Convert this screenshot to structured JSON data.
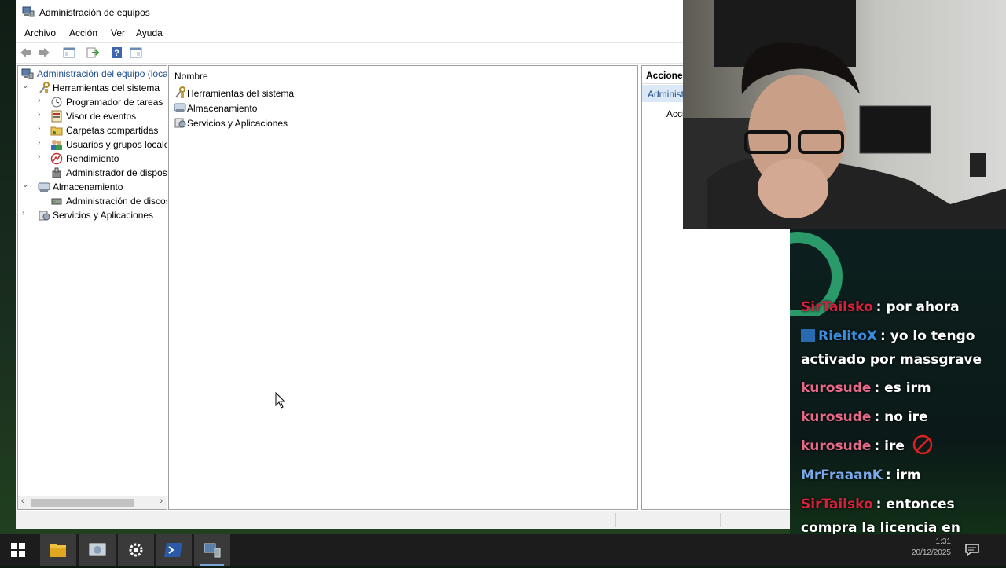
{
  "window": {
    "title": "Administración de equipos",
    "menu": [
      "Archivo",
      "Acción",
      "Ver",
      "Ayuda"
    ]
  },
  "tree": {
    "root": "Administración del equipo (local)",
    "items": [
      {
        "label": "Herramientas del sistema",
        "level": 1,
        "expanded": true,
        "icon": "tools-icon"
      },
      {
        "label": "Programador de tareas",
        "level": 2,
        "expanded": false,
        "icon": "clock-icon"
      },
      {
        "label": "Visor de eventos",
        "level": 2,
        "expanded": false,
        "icon": "event-viewer-icon"
      },
      {
        "label": "Carpetas compartidas",
        "level": 2,
        "expanded": false,
        "icon": "shared-folder-icon"
      },
      {
        "label": "Usuarios y grupos locales",
        "level": 2,
        "expanded": false,
        "icon": "users-icon"
      },
      {
        "label": "Rendimiento",
        "level": 2,
        "expanded": false,
        "icon": "performance-icon"
      },
      {
        "label": "Administrador de dispositivos",
        "level": 2,
        "expanded": null,
        "icon": "device-manager-icon"
      },
      {
        "label": "Almacenamiento",
        "level": 1,
        "expanded": true,
        "icon": "storage-icon"
      },
      {
        "label": "Administración de discos",
        "level": 2,
        "expanded": null,
        "icon": "disk-icon"
      },
      {
        "label": "Servicios y Aplicaciones",
        "level": 1,
        "expanded": false,
        "icon": "services-icon"
      }
    ]
  },
  "content": {
    "column_header": "Nombre",
    "rows": [
      {
        "label": "Herramientas del sistema",
        "icon": "tools-icon"
      },
      {
        "label": "Almacenamiento",
        "icon": "storage-icon"
      },
      {
        "label": "Servicios y Aplicaciones",
        "icon": "services-icon"
      }
    ]
  },
  "actions": {
    "header": "Acciones",
    "selected": "Administración del equipo (local)",
    "item": "Acciones adicionales"
  },
  "chat": {
    "messages": [
      {
        "user": "SirTailsko",
        "text": ": por ahora",
        "color": "#d8203a"
      },
      {
        "user": "RielitoX",
        "text": ": yo lo tengo activado por massgrave",
        "color": "#3a8de0"
      },
      {
        "user": "kurosude",
        "text": ": es irm",
        "color": "#e86a8a"
      },
      {
        "user": "kurosude",
        "text": ": no ire",
        "color": "#e86a8a"
      },
      {
        "user": "kurosude",
        "text": ": ire",
        "color": "#e86a8a"
      },
      {
        "user": "MrFraaanK",
        "text": ": irm",
        "color": "#7aa8e8"
      },
      {
        "user": "SirTailsko",
        "text": ": entonces compra la licencia en keysfan punto com",
        "color": "#d8203a"
      }
    ]
  },
  "taskbar": {
    "time": "1:31",
    "date": "20/12/2025"
  }
}
